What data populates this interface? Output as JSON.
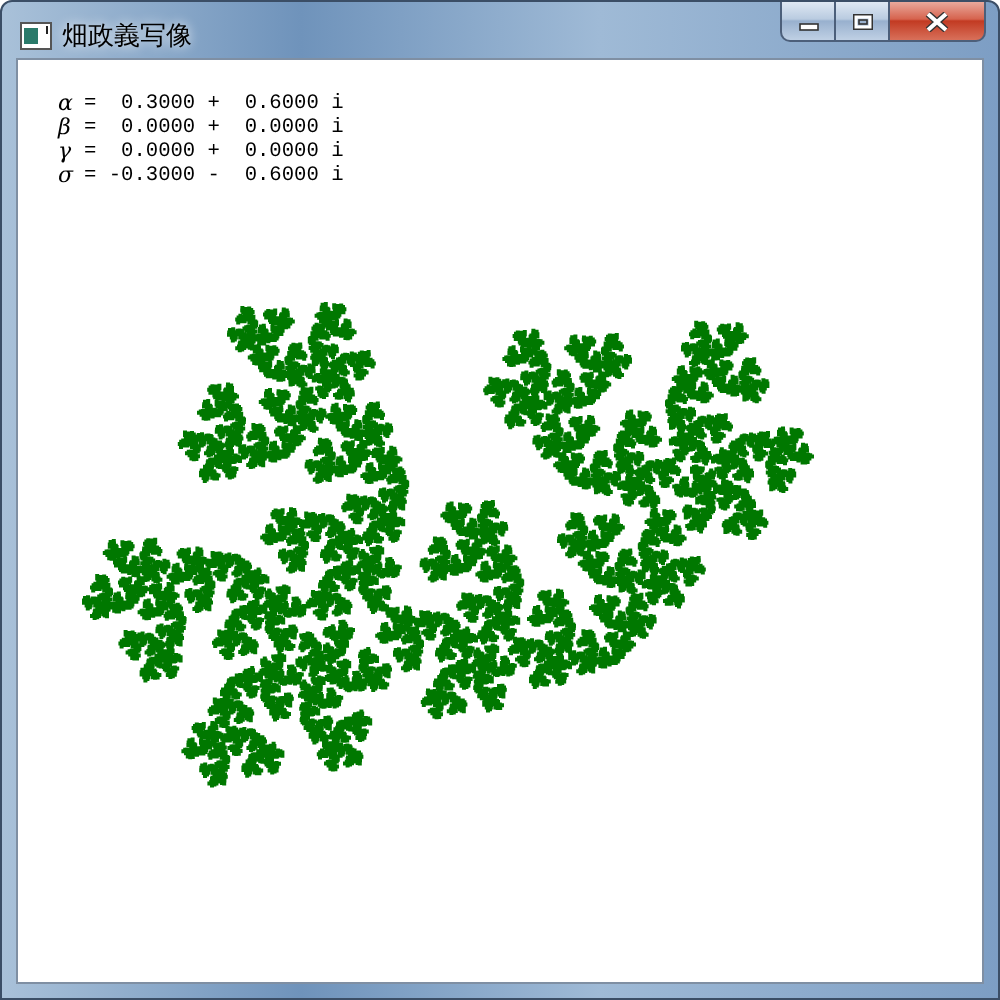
{
  "window": {
    "title": "畑政義写像",
    "buttons": [
      {
        "kind": "minimize"
      },
      {
        "kind": "maximize"
      },
      {
        "kind": "close"
      }
    ]
  },
  "parameters": [
    {
      "symbol": "α",
      "value": "=  0.3000 +  0.6000 i"
    },
    {
      "symbol": "β",
      "value": "=  0.0000 +  0.0000 i"
    },
    {
      "symbol": "γ",
      "value": "=  0.0000 +  0.0000 i"
    },
    {
      "symbol": "σ",
      "value": "= -0.3000 -  0.6000 i"
    }
  ]
}
